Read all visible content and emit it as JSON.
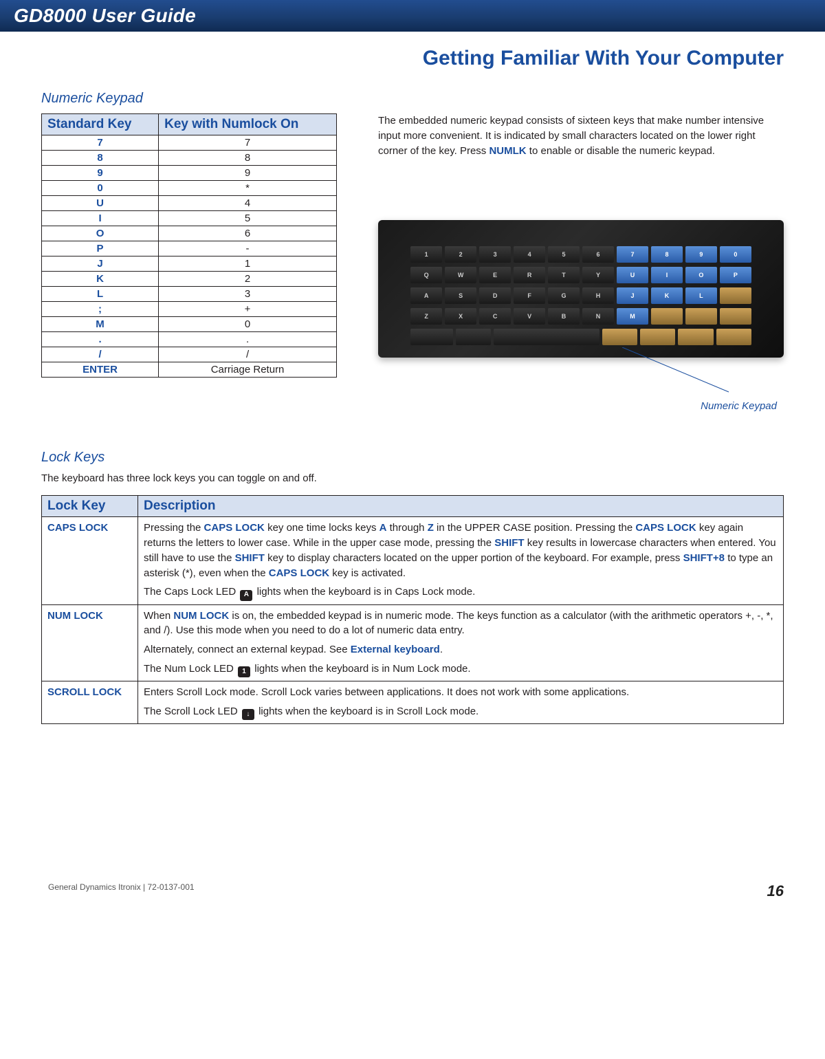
{
  "header": {
    "title": "GD8000 User Guide"
  },
  "chapter_title": "Getting Familiar With Your Computer",
  "sections": {
    "numeric_keypad": {
      "heading": "Numeric Keypad",
      "table_headers": {
        "std": "Standard Key",
        "numlock": "Key with Numlock On"
      },
      "rows": [
        {
          "std": "7",
          "nl": "7"
        },
        {
          "std": "8",
          "nl": "8"
        },
        {
          "std": "9",
          "nl": "9"
        },
        {
          "std": "0",
          "nl": "*"
        },
        {
          "std": "U",
          "nl": "4"
        },
        {
          "std": "I",
          "nl": "5"
        },
        {
          "std": "O",
          "nl": "6"
        },
        {
          "std": "P",
          "nl": "-"
        },
        {
          "std": "J",
          "nl": "1"
        },
        {
          "std": "K",
          "nl": "2"
        },
        {
          "std": "L",
          "nl": "3"
        },
        {
          "std": ";",
          "nl": "+"
        },
        {
          "std": "M",
          "nl": "0"
        },
        {
          "std": ".",
          "nl": "."
        },
        {
          "std": "/",
          "nl": "/"
        },
        {
          "std": "ENTER",
          "nl": "Carriage Return"
        }
      ],
      "paragraph_parts": {
        "p1": "The embedded numeric keypad consists of sixteen keys that make number intensive input more convenient. It is indicated by small characters located on the lower right corner of the key. Press ",
        "numlk": "NUMLK",
        "p2": " to enable or disable the numeric keypad."
      },
      "keyboard_image_caption": "Numeric Keypad"
    },
    "lock_keys": {
      "heading": "Lock Keys",
      "intro": "The keyboard has three lock keys you can toggle on and off.",
      "table_headers": {
        "key": "Lock Key",
        "desc": "Description"
      },
      "rows": {
        "caps": {
          "name": "CAPS LOCK",
          "p1a": "Pressing the ",
          "k_caps1": "CAPS LOCK",
          "p1b": " key one time locks keys ",
          "k_a": "A",
          "p1c": " through ",
          "k_z": "Z",
          "p1d": " in the UPPER CASE position. Pressing the ",
          "k_caps2": "CAPS LOCK",
          "p1e": " key again returns the letters to lower case. While in the upper case mode, pressing the ",
          "k_shift1": "SHIFT",
          "p1f": " key results in lowercase characters when entered. You still have to use the ",
          "k_shift2": "SHIFT",
          "p1g": " key to display characters located on the upper portion of the keyboard. For example, press ",
          "k_shift8": "SHIFT+8",
          "p1h": " to type an asterisk (*), even when the ",
          "k_caps3": "CAPS LOCK",
          "p1i": " key is activated.",
          "p2a": "The Caps Lock LED ",
          "icon": "A",
          "p2b": " lights when the keyboard is in Caps Lock mode."
        },
        "num": {
          "name": "NUM LOCK",
          "p1a": "When ",
          "k_num": "NUM LOCK",
          "p1b": " is on, the embedded keypad is in numeric mode. The keys function as a calculator (with the arithmetic operators +, -, *, and /). Use this mode when you need to do a lot of numeric data entry.",
          "p2a": "Alternately, connect an external keypad. See ",
          "k_ext": "External keyboard",
          "p2b": ".",
          "p3a": "The Num Lock LED ",
          "icon": "1",
          "p3b": " lights when the keyboard is in Num Lock mode."
        },
        "scroll": {
          "name": "SCROLL LOCK",
          "p1": "Enters Scroll Lock mode. Scroll Lock varies between applications. It does not work with some applications.",
          "p2a": "The Scroll Lock LED ",
          "icon": "↓",
          "p2b": " lights when the keyboard is in Scroll Lock mode."
        }
      }
    }
  },
  "footer": {
    "left": "General Dynamics Itronix | 72-0137-001",
    "page": "16"
  }
}
